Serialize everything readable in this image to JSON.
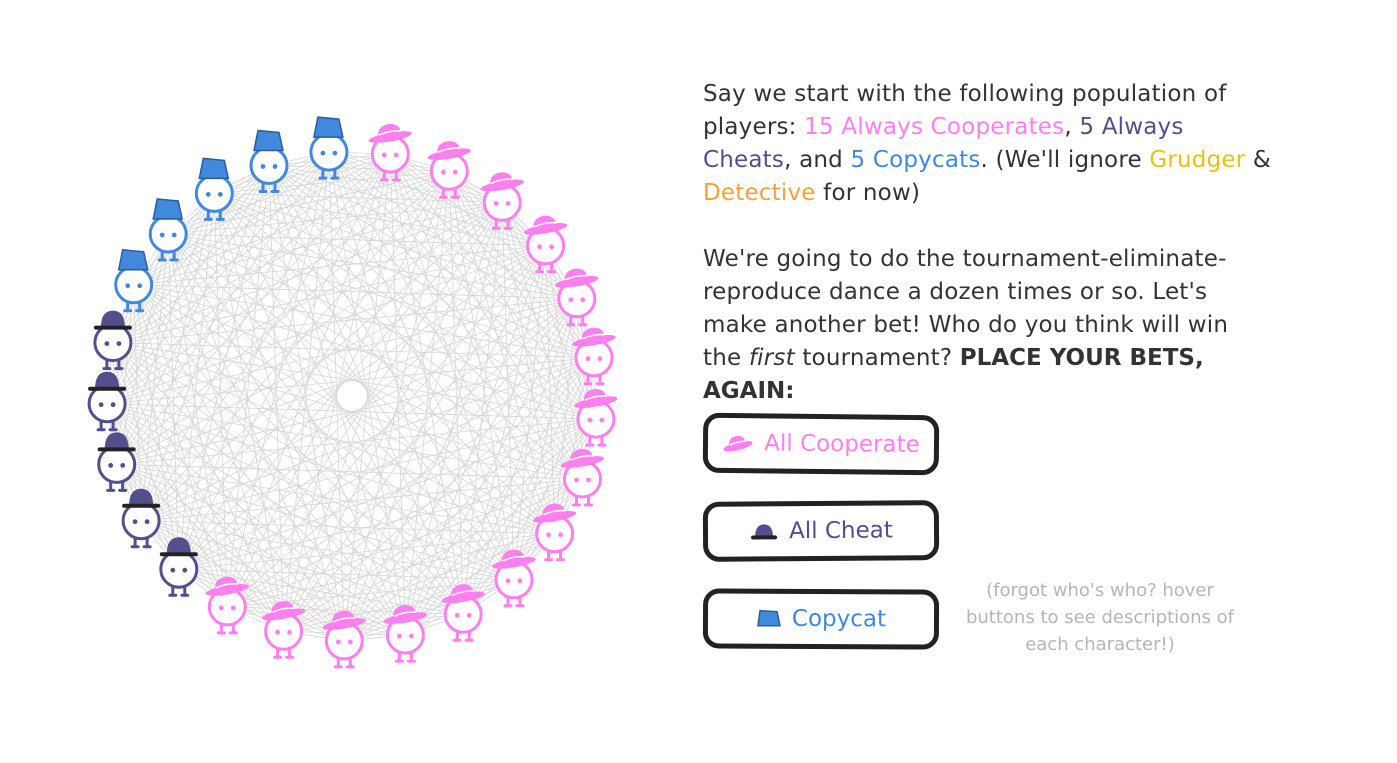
{
  "narration": {
    "p1_a": "Say we start with the following population of players: ",
    "p1_coop": "15 Always Cooperates",
    "p1_b": ", ",
    "p1_cheat": "5 Always Cheats",
    "p1_c": ", and ",
    "p1_copy": "5 Copycats",
    "p1_d": ". (We'll ignore ",
    "p1_grudge": "Grudger",
    "p1_e": " & ",
    "p1_detect": "Detective",
    "p1_f": " for now)",
    "p2_a": "We're going to do the tournament-eliminate-reproduce dance a dozen times or so. Let's make another bet! Who do you think will win the ",
    "p2_first": "first",
    "p2_b": " tournament? ",
    "p2_bold": "PLACE YOUR BETS, AGAIN:"
  },
  "buttons": {
    "cooperate": "All Cooperate",
    "cheat": "All Cheat",
    "copycat": "Copycat"
  },
  "hint": "(forgot who's who? hover buttons to see descriptions of each character!)",
  "population": {
    "always_cooperate": 15,
    "always_cheat": 5,
    "copycat": 5
  },
  "icons": {
    "cooperate": "pink-hat-icon",
    "cheat": "bowler-hat-icon",
    "copycat": "blue-cap-icon"
  },
  "colors": {
    "cooperate": "#ff7ef0",
    "cheat": "#51508c",
    "copycat": "#4089dd",
    "grudger": "#e7c11a",
    "detective": "#f3a23a",
    "lines": "#d6d6d6",
    "button_border": "#222222"
  }
}
